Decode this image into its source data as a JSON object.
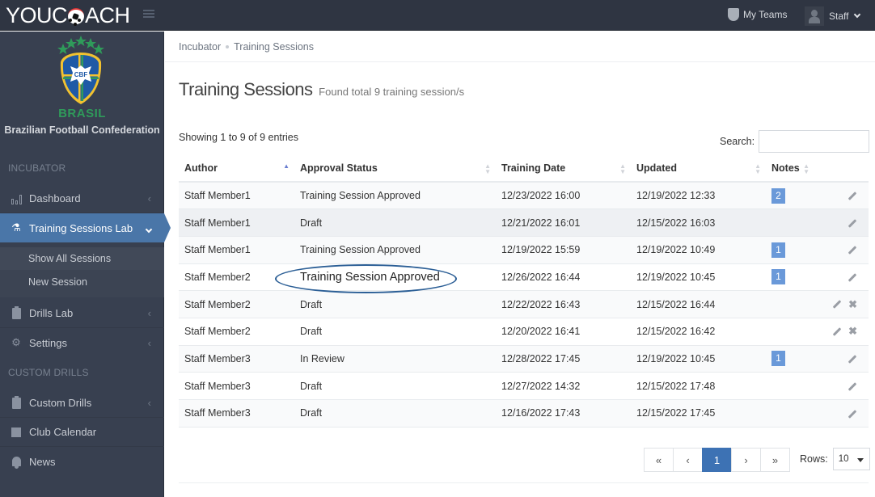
{
  "app": {
    "logo_text_pre": "YOUC",
    "logo_text_post": "ACH",
    "top_nav": {
      "my_teams_label": "My Teams",
      "user_label": "Staff"
    }
  },
  "sidebar": {
    "org": {
      "crest_text": "CBF",
      "country": "BRASIL",
      "name": "Brazilian Football Confederation"
    },
    "sections": [
      {
        "title": "INCUBATOR"
      },
      {
        "title": "CUSTOM DRILLS"
      }
    ],
    "items": [
      {
        "label": "Dashboard",
        "icon": "bar-chart-icon"
      },
      {
        "label": "Training Sessions Lab",
        "icon": "flask-icon",
        "active": true
      },
      {
        "label": "Drills Lab",
        "icon": "clipboard-icon"
      },
      {
        "label": "Settings",
        "icon": "gear-icon"
      },
      {
        "label": "Custom Drills",
        "icon": "clipboard-icon"
      },
      {
        "label": "Club Calendar",
        "icon": "calendar-icon"
      },
      {
        "label": "News",
        "icon": "bell-icon"
      }
    ],
    "sub_items": [
      {
        "label": "Show All Sessions",
        "current": true
      },
      {
        "label": "New Session"
      }
    ]
  },
  "breadcrumb": [
    "Incubator",
    "Training Sessions"
  ],
  "main": {
    "title": "Training Sessions",
    "subtitle": "Found total 9 training session/s",
    "info": "Showing 1 to 9 of 9 entries",
    "search_label": "Search:",
    "search_value": "",
    "table": {
      "columns": [
        "Author",
        "Approval Status",
        "Training Date",
        "Updated",
        "Notes"
      ],
      "sorted_column": "Author",
      "sort_direction": "asc",
      "rows": [
        {
          "author": "Staff Member1",
          "status": "Training Session Approved",
          "training_date": "12/23/2022 16:00",
          "updated": "12/19/2022 12:33",
          "notes": "2",
          "actions": [
            "edit"
          ]
        },
        {
          "author": "Staff Member1",
          "status": "Draft",
          "training_date": "12/21/2022 16:01",
          "updated": "12/15/2022 16:03",
          "notes": "",
          "actions": [
            "edit"
          ]
        },
        {
          "author": "Staff Member1",
          "status": "Training Session Approved",
          "training_date": "12/19/2022 15:59",
          "updated": "12/19/2022 10:49",
          "notes": "1",
          "actions": [
            "edit"
          ]
        },
        {
          "author": "Staff Member2",
          "status": "Training Session Approved",
          "training_date": "12/26/2022 16:44",
          "updated": "12/19/2022 10:45",
          "notes": "1",
          "actions": [
            "edit"
          ],
          "highlighted": true
        },
        {
          "author": "Staff Member2",
          "status": "Draft",
          "training_date": "12/22/2022 16:43",
          "updated": "12/15/2022 16:44",
          "notes": "",
          "actions": [
            "edit",
            "delete"
          ]
        },
        {
          "author": "Staff Member2",
          "status": "Draft",
          "training_date": "12/20/2022 16:41",
          "updated": "12/15/2022 16:42",
          "notes": "",
          "actions": [
            "edit",
            "delete"
          ]
        },
        {
          "author": "Staff Member3",
          "status": "In Review",
          "training_date": "12/28/2022 17:45",
          "updated": "12/19/2022 10:45",
          "notes": "1",
          "actions": [
            "edit"
          ]
        },
        {
          "author": "Staff Member3",
          "status": "Draft",
          "training_date": "12/27/2022 14:32",
          "updated": "12/15/2022 17:48",
          "notes": "",
          "actions": [
            "edit"
          ]
        },
        {
          "author": "Staff Member3",
          "status": "Draft",
          "training_date": "12/16/2022 17:43",
          "updated": "12/15/2022 17:45",
          "notes": "",
          "actions": [
            "edit"
          ]
        }
      ]
    },
    "pagination": {
      "first": "«",
      "prev": "‹",
      "current_page": "1",
      "next": "›",
      "last": "»",
      "rows_label": "Rows:",
      "rows_value": "10"
    }
  },
  "colors": {
    "topbar": "#2f3542",
    "sidebar": "#384050",
    "active_nav": "#4a76a8",
    "badge": "#6a99d9",
    "page_active": "#3d72b4",
    "annotation": "#2c5f96"
  }
}
